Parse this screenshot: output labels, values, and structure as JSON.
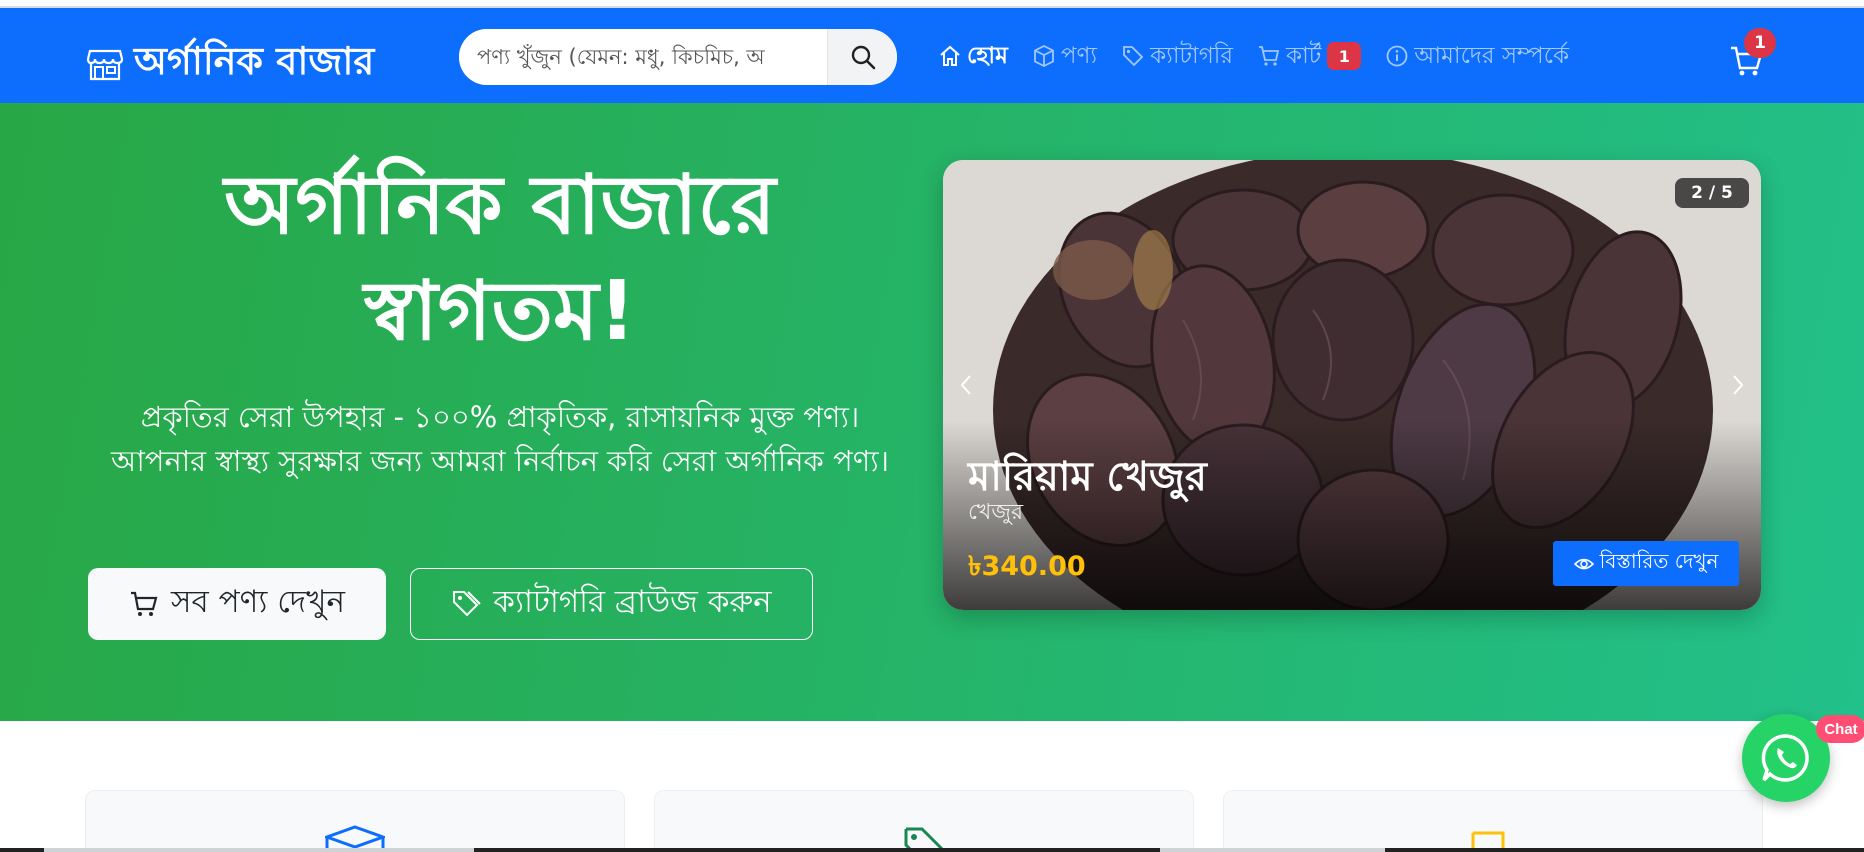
{
  "navbar": {
    "brand": "অর্গানিক বাজার",
    "search_placeholder": "পণ্য খুঁজুন (যেমন: মধু, কিচমিচ, অ",
    "nav_items": [
      {
        "label": "হোম",
        "icon": "house-icon",
        "active": true
      },
      {
        "label": "পণ্য",
        "icon": "box-icon",
        "active": false
      },
      {
        "label": "ক্যাটাগরি",
        "icon": "tag-icon",
        "active": false
      },
      {
        "label": "কার্ট",
        "icon": "cart-icon",
        "active": false,
        "badge": "1"
      },
      {
        "label": "আমাদের সম্পর্কে",
        "icon": "info-icon",
        "active": false
      }
    ],
    "cart_badge": "1"
  },
  "hero": {
    "title_line1": "অর্গানিক বাজারে",
    "title_line2": "স্বাগতম!",
    "subtitle": "প্রকৃতির সেরা উপহার - ১০০% প্রাকৃতিক, রাসায়নিক মুক্ত পণ্য। আপনার স্বাস্থ্য সুরক্ষার জন্য আমরা নির্বাচন করি সেরা অর্গানিক পণ্য।",
    "btn_products": "সব পণ্য দেখুন",
    "btn_categories": "ক্যাটাগরি ব্রাউজ করুন"
  },
  "carousel": {
    "counter": "2 / 5",
    "product_name": "মারিয়াম খেজুর",
    "category": "খেজুর",
    "price": "৳340.00",
    "details_btn": "বিস্তারিত দেখুন",
    "total_slides": 5,
    "active_slide": 2
  },
  "chat": {
    "badge": "Chat"
  },
  "colors": {
    "primary": "#0d6efd",
    "hero_start": "#28a745",
    "hero_end": "#22c08a",
    "danger": "#dc3545",
    "price": "#ffc107",
    "whatsapp": "#25d366"
  }
}
